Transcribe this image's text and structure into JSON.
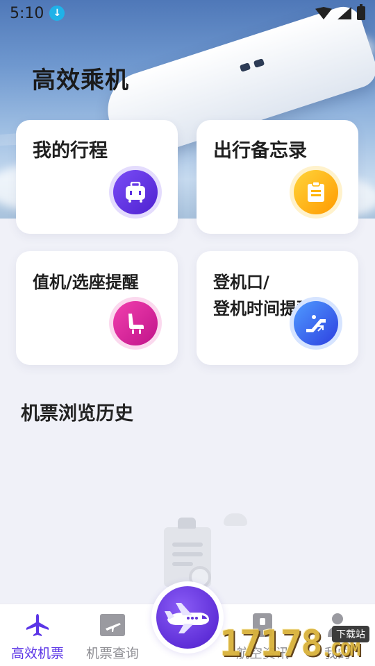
{
  "status_bar": {
    "time": "5:10",
    "download_icon": "download-icon"
  },
  "app": {
    "title": "高效乘机"
  },
  "cards": [
    {
      "label": "我的行程",
      "icon": "luggage-icon",
      "color": "#6a3df0"
    },
    {
      "label": "出行备忘录",
      "icon": "clipboard-icon",
      "color": "#ffb300"
    },
    {
      "label": "值机/选座提醒",
      "icon": "seat-icon",
      "color": "#e0239b"
    },
    {
      "label_line1": "登机口/",
      "label_line2": "登机时间提醒",
      "icon": "escalator-icon",
      "color": "#2f6ff0"
    }
  ],
  "history": {
    "title": "机票浏览历史"
  },
  "tabbar": {
    "tabs": [
      {
        "label": "高效机票",
        "icon": "airplane-icon",
        "active": true
      },
      {
        "label": "机票查询",
        "icon": "ticket-icon",
        "active": false
      },
      {
        "label": "航空资讯",
        "icon": "news-icon",
        "active": false
      },
      {
        "label": "我的",
        "icon": "person-icon",
        "active": false
      }
    ],
    "center_icon": "plane-cartoon-icon"
  },
  "watermark": {
    "text": "17178",
    "suffix": ".COM",
    "badge": "下载站"
  },
  "colors": {
    "accent": "#5b35e6",
    "inactive": "#8e8e93"
  }
}
